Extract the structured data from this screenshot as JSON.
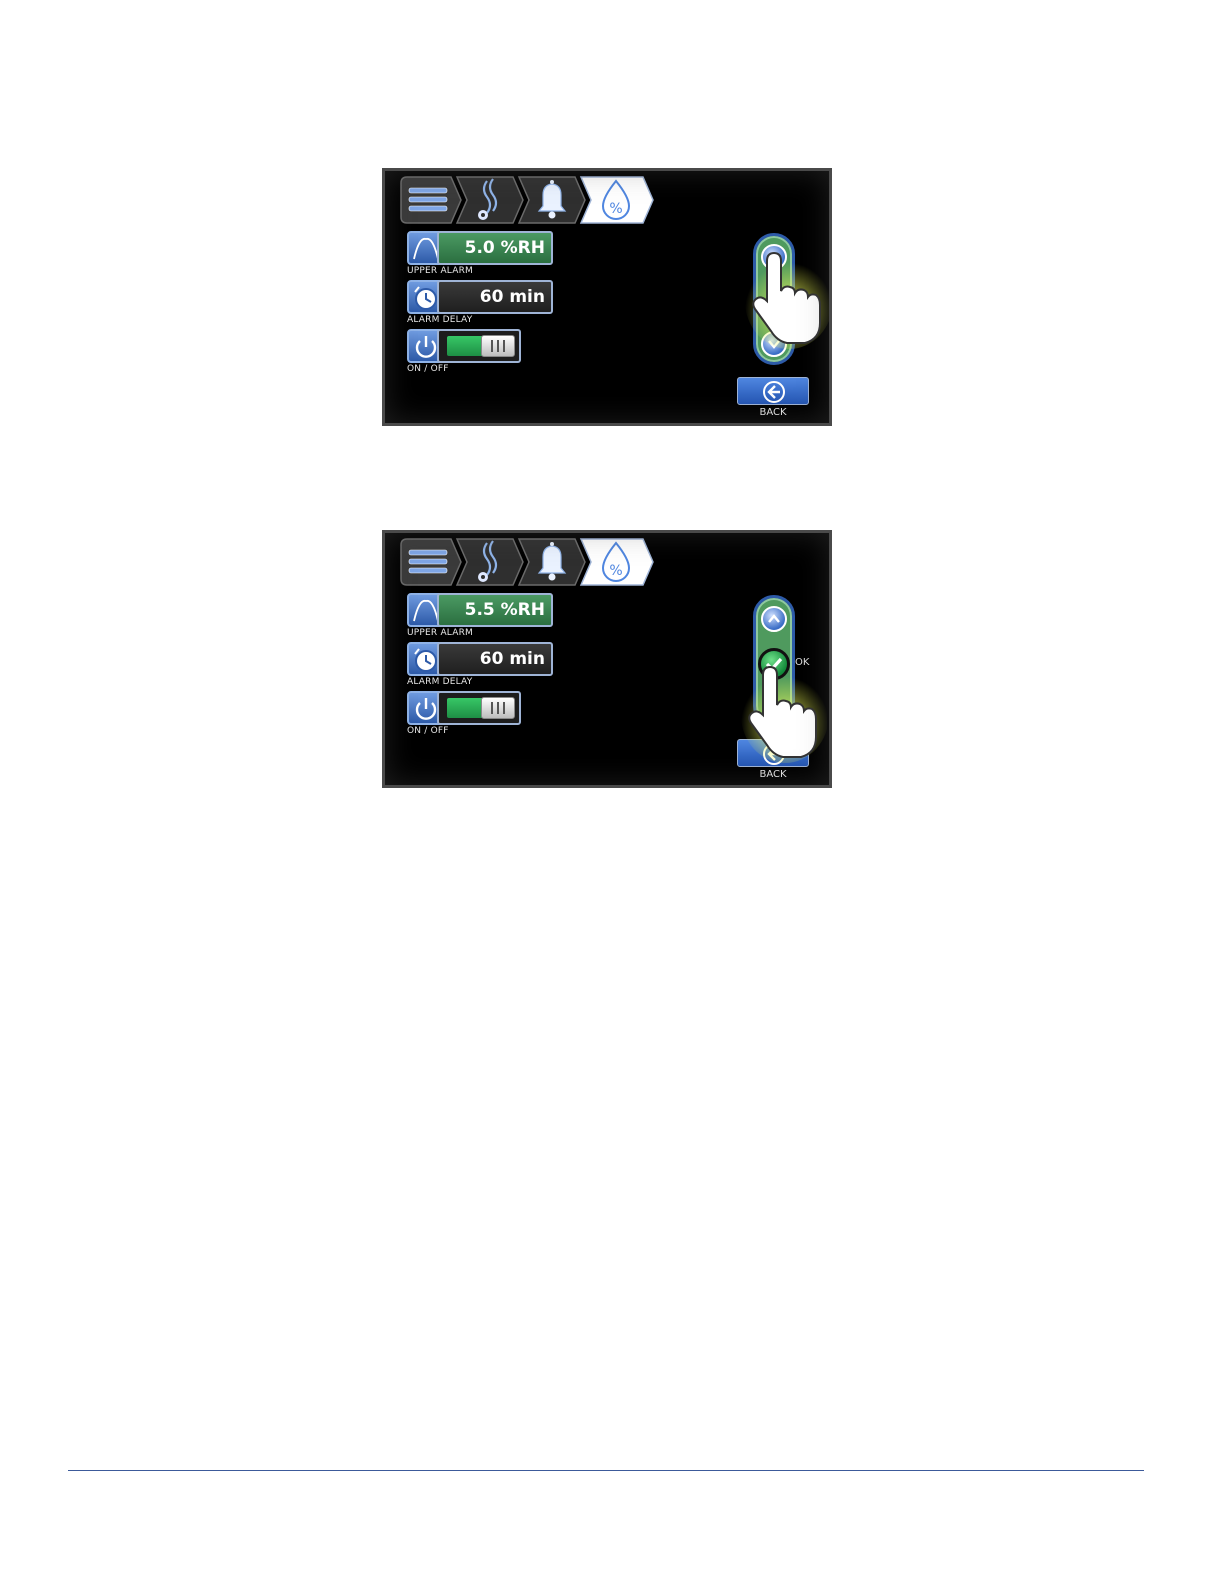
{
  "screens": [
    {
      "breadcrumb": [
        "menu-icon",
        "steam-settings-icon",
        "bell-icon",
        "humidity-percent-icon"
      ],
      "upper_alarm": {
        "value": "5.0 %RH",
        "label": "UPPER ALARM",
        "icon": "peak-curve-icon"
      },
      "alarm_delay": {
        "value": "60 min",
        "label": "ALARM DELAY",
        "icon": "clock-icon"
      },
      "on_off": {
        "label": "ON / OFF",
        "state": "on",
        "icon": "power-icon"
      },
      "stepper": {
        "up_icon": "chevron-up-icon",
        "down_icon": "chevron-down-icon",
        "pressed": "up"
      },
      "back": {
        "label": "BACK",
        "icon": "arrow-left-circle-icon"
      }
    },
    {
      "breadcrumb": [
        "menu-icon",
        "steam-settings-icon",
        "bell-icon",
        "humidity-percent-icon"
      ],
      "upper_alarm": {
        "value": "5.5 %RH",
        "label": "UPPER ALARM",
        "icon": "peak-curve-icon"
      },
      "alarm_delay": {
        "value": "60 min",
        "label": "ALARM DELAY",
        "icon": "clock-icon"
      },
      "on_off": {
        "label": "ON / OFF",
        "state": "on",
        "icon": "power-icon"
      },
      "stepper": {
        "up_icon": "chevron-up-icon",
        "ok_icon": "check-icon",
        "ok_label": "OK",
        "pressed": "ok"
      },
      "back": {
        "label": "BACK",
        "icon": "arrow-left-circle-icon"
      }
    }
  ],
  "colors": {
    "screen_bg": "#000000",
    "value_green": "#3f8a55",
    "accent_blue": "#2d5aa8",
    "highlight_yellow": "#e8f24a",
    "footer_rule": "#3c5a9a"
  }
}
